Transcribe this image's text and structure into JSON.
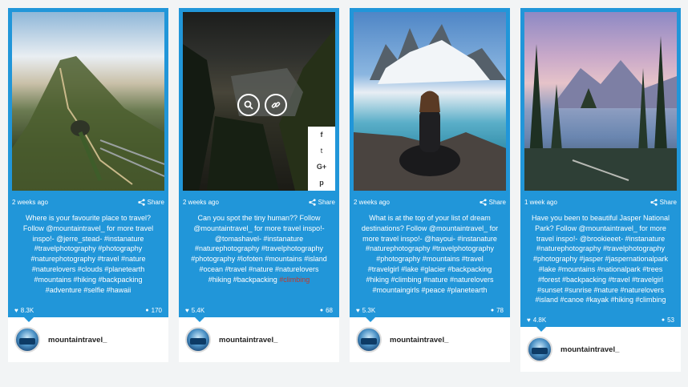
{
  "share_label": "Share",
  "username": "mountaintravel_",
  "avatar_text": "MOUNTAIN TRAVEL",
  "share_menu": [
    "f",
    "t",
    "G+",
    "p"
  ],
  "colors": {
    "card_blue": "#2196d9",
    "highlight": "#c0392b"
  },
  "cards": [
    {
      "time": "2 weeks ago",
      "caption": "Where is your favourite place to travel? Follow @mountaintravel_ for more travel inspo!- @jerre_stead- #instanature #travelphotography #photography #naturephotography #travel #nature #naturelovers #clouds #planetearth #mountains #hiking #backpacking #adventure #selfie #hawaii",
      "likes": "8.3K",
      "comments": "170"
    },
    {
      "time": "2 weeks ago",
      "caption": "Can you spot the tiny human?? Follow @mountaintravel_ for more travel inspo!- @tomashavel- #instanature #naturephotography #travelphotography #photography #lofoten #mountains #island #ocean #travel #nature #naturelovers #hiking #backpacking ",
      "caption_highlight": "#climbing",
      "likes": "5.4K",
      "comments": "68"
    },
    {
      "time": "2 weeks ago",
      "caption": "What is at the top of your list of dream destinations? Follow @mountaintravel_ for more travel inspo!- @hayoui- #instanature #naturephotography #travelphotography #photography #mountains #travel #travelgirl #lake #glacier #backpacking #hiking #climbing #nature #naturelovers #mountaingirls #peace #planetearth",
      "likes": "5.3K",
      "comments": "78"
    },
    {
      "time": "1 week ago",
      "caption": "Have you been to beautiful Jasper National Park? Follow @mountaintravel_ for more travel inspo!- @brookieeet- #instanature #naturephotography #travelphotography #photography #jasper #jaspernationalpark #lake #mountains #nationalpark #trees #forest #backpacking #travel #travelgirl #sunset #sunrise #nature #naturelovers #island #canoe #kayak #hiking #climbing",
      "likes": "4.8K",
      "comments": "53"
    }
  ]
}
